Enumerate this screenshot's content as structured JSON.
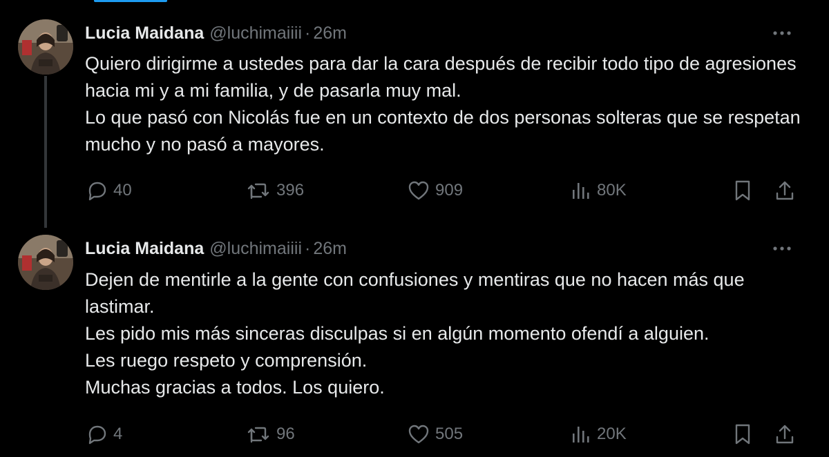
{
  "colors": {
    "background": "#000000",
    "text_primary": "#e7e9ea",
    "text_secondary": "#71767b",
    "accent": "#1d9bf0",
    "thread_line": "#333639"
  },
  "tweets": [
    {
      "author": {
        "name": "Lucia Maidana",
        "handle": "@luchimaiiii",
        "separator": "·",
        "time": "26m",
        "avatar": "profile-photo"
      },
      "text": [
        "Quiero dirigirme a ustedes para dar la cara después de recibir todo tipo de agresiones hacia mi y a mi familia, y de pasarla muy mal.",
        "Lo que pasó con Nicolás fue en un contexto de dos personas solteras que se respetan mucho y no pasó a mayores."
      ],
      "stats": {
        "replies": "40",
        "reposts": "396",
        "likes": "909",
        "views": "80K"
      }
    },
    {
      "author": {
        "name": "Lucia Maidana",
        "handle": "@luchimaiiii",
        "separator": "·",
        "time": "26m",
        "avatar": "profile-photo"
      },
      "text": [
        "Dejen de mentirle a la gente con confusiones y mentiras que no hacen más que lastimar.",
        "Les pido mis más sinceras disculpas si en algún momento ofendí a alguien.",
        "Les ruego respeto y comprensión.",
        "Muchas gracias a todos. Los quiero."
      ],
      "stats": {
        "replies": "4",
        "reposts": "96",
        "likes": "505",
        "views": "20K"
      }
    }
  ],
  "icons": {
    "reply": "reply-icon",
    "repost": "repost-icon",
    "like": "heart-icon",
    "views": "views-chart-icon",
    "bookmark": "bookmark-icon",
    "share": "share-icon",
    "more": "more-dots-icon"
  }
}
